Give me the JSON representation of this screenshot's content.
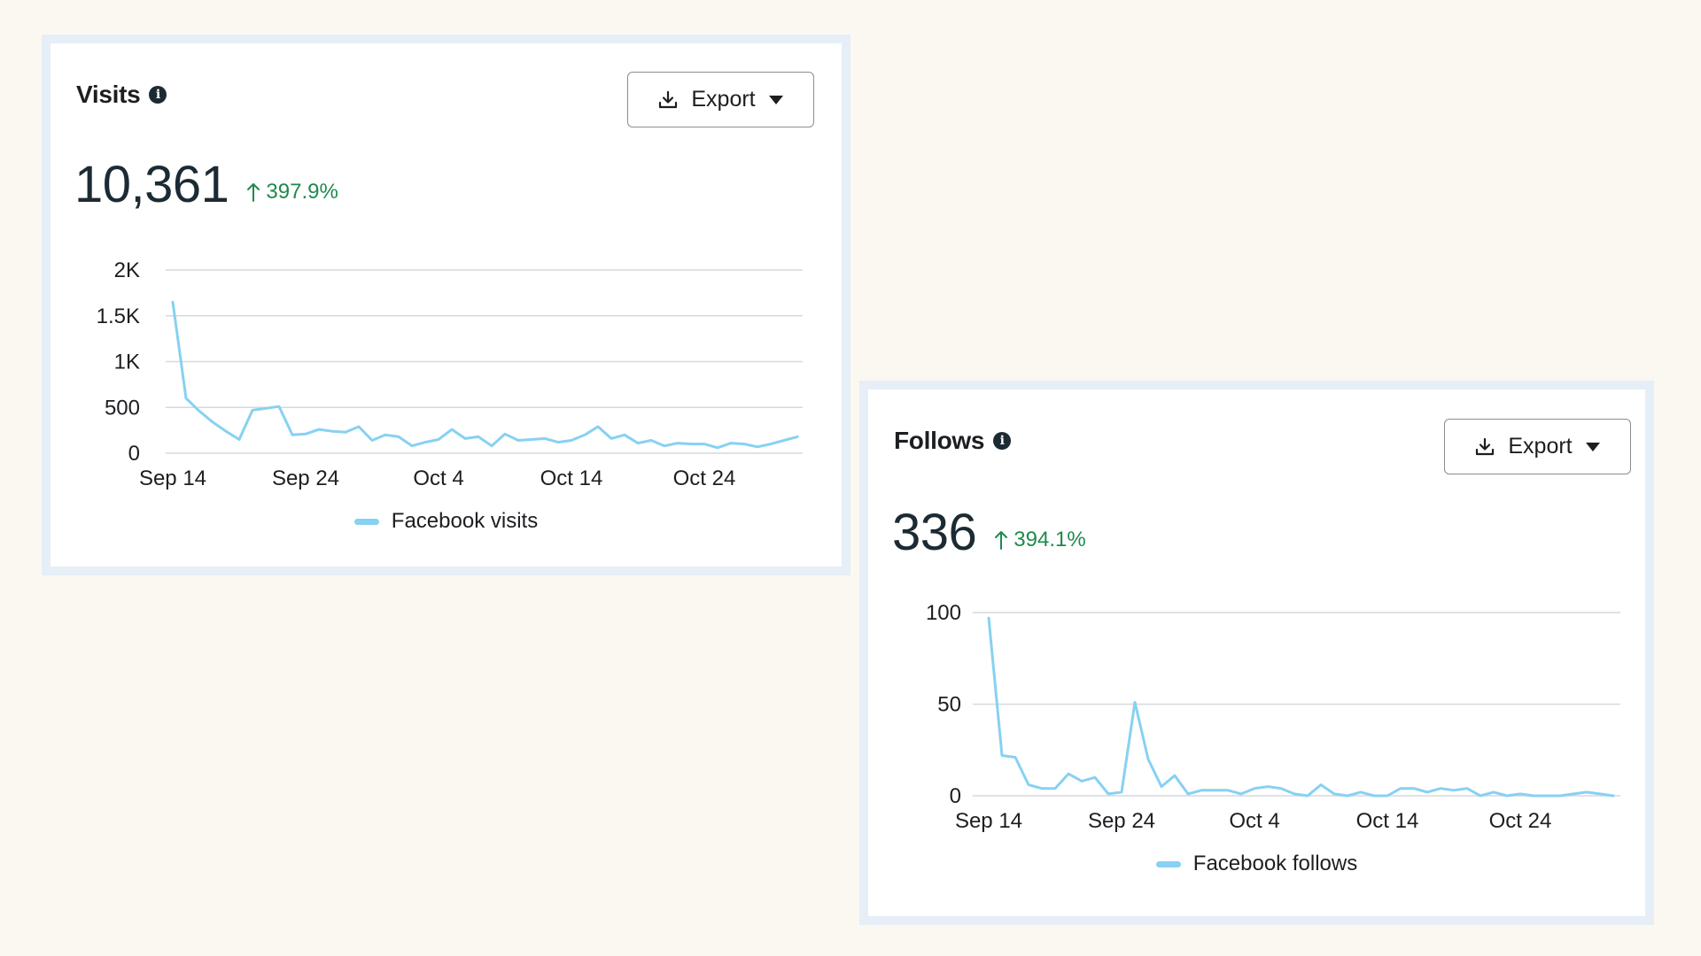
{
  "visits_card": {
    "title": "Visits",
    "export_label": "Export",
    "total": "10,361",
    "change": "397.9%",
    "legend_label": "Facebook visits"
  },
  "follows_card": {
    "title": "Follows",
    "export_label": "Export",
    "total": "336",
    "change": "394.1%",
    "legend_label": "Facebook follows"
  },
  "colors": {
    "series_line": "#87d1f2",
    "positive_change": "#1e8a4c",
    "gridline": "#d6d9dd"
  },
  "icons": {
    "info": "info-icon",
    "export": "download-icon",
    "dropdown": "caret-down-icon",
    "change": "arrow-up-icon"
  },
  "chart_data": [
    {
      "type": "line",
      "x_start_label": "Sep 14",
      "x_tick_labels": [
        "Sep 14",
        "Sep 24",
        "Oct 4",
        "Oct 14",
        "Oct 24"
      ],
      "y_tick_labels": [
        "0",
        "500",
        "1K",
        "1.5K",
        "2K"
      ],
      "y_ticks": [
        0,
        500,
        1000,
        1500,
        2000
      ],
      "ylim": [
        0,
        2000
      ],
      "grid": true,
      "legend_position": "bottom-center",
      "series": [
        {
          "name": "Facebook visits",
          "values": [
            1650,
            600,
            460,
            340,
            240,
            150,
            470,
            490,
            510,
            200,
            210,
            260,
            240,
            230,
            290,
            140,
            200,
            180,
            80,
            120,
            150,
            260,
            160,
            180,
            80,
            210,
            140,
            150,
            160,
            120,
            140,
            200,
            290,
            160,
            200,
            110,
            140,
            80,
            110,
            100,
            100,
            60,
            110,
            100,
            70,
            100,
            140,
            180
          ]
        }
      ]
    },
    {
      "type": "line",
      "x_start_label": "Sep 14",
      "x_tick_labels": [
        "Sep 14",
        "Sep 24",
        "Oct 4",
        "Oct 14",
        "Oct 24"
      ],
      "y_tick_labels": [
        "0",
        "50",
        "100"
      ],
      "y_ticks": [
        0,
        50,
        100
      ],
      "ylim": [
        0,
        100
      ],
      "grid": true,
      "legend_position": "bottom-center",
      "series": [
        {
          "name": "Facebook follows",
          "values": [
            97,
            22,
            21,
            6,
            4,
            4,
            12,
            8,
            10,
            1,
            2,
            51,
            20,
            5,
            11,
            1,
            3,
            3,
            3,
            1,
            4,
            5,
            4,
            1,
            0,
            6,
            1,
            0,
            2,
            0,
            0,
            4,
            4,
            2,
            4,
            3,
            4,
            0,
            2,
            0,
            1,
            0,
            0,
            0,
            1,
            2,
            1,
            0
          ]
        }
      ]
    }
  ]
}
